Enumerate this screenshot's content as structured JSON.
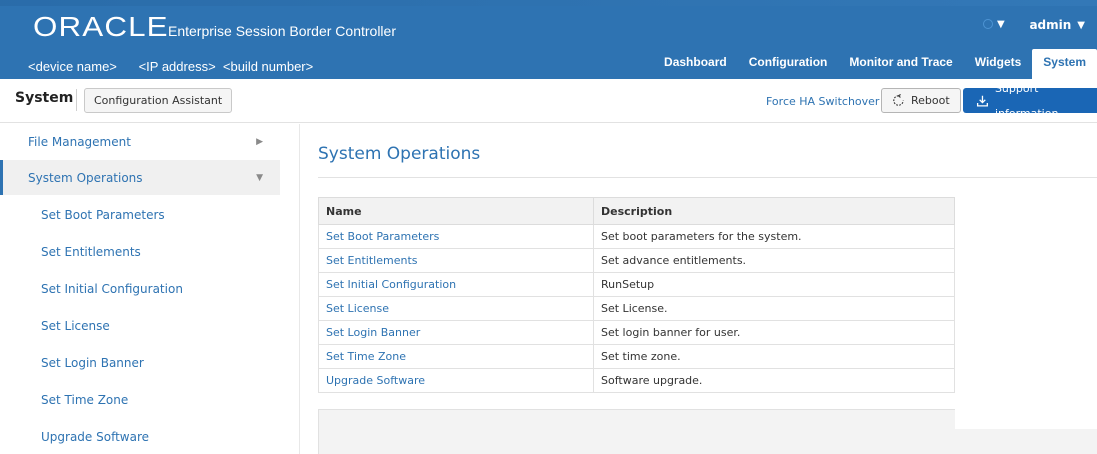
{
  "header": {
    "logo": "ORACLE",
    "app_title": "Enterprise Session Border Controller",
    "device_info": "<device name>      <IP address>  <build number>",
    "user": "admin",
    "nav_tabs": [
      {
        "label": "Dashboard",
        "active": false
      },
      {
        "label": "Configuration",
        "active": false
      },
      {
        "label": "Monitor and Trace",
        "active": false
      },
      {
        "label": "Widgets",
        "active": false
      },
      {
        "label": "System",
        "active": true
      }
    ]
  },
  "subheader": {
    "title": "System",
    "config_assistant": "Configuration Assistant",
    "ha_switchover": "Force HA Switchover",
    "reboot": "Reboot",
    "support": "Support information"
  },
  "sidebar": {
    "items": [
      {
        "label": "File Management",
        "expanded": false
      },
      {
        "label": "System Operations",
        "expanded": true
      }
    ],
    "sub_items": [
      "Set Boot Parameters",
      "Set Entitlements",
      "Set Initial Configuration",
      "Set License",
      "Set Login Banner",
      "Set Time Zone",
      "Upgrade Software"
    ]
  },
  "content": {
    "title": "System Operations",
    "columns": [
      "Name",
      "Description"
    ],
    "rows": [
      {
        "name": "Set Boot Parameters",
        "description": "Set boot parameters for the system."
      },
      {
        "name": "Set Entitlements",
        "description": "Set advance entitlements."
      },
      {
        "name": "Set Initial Configuration",
        "description": "RunSetup"
      },
      {
        "name": "Set License",
        "description": "Set License."
      },
      {
        "name": "Set Login Banner",
        "description": "Set login banner for user."
      },
      {
        "name": "Set Time Zone",
        "description": "Set time zone."
      },
      {
        "name": "Upgrade Software",
        "description": "Software upgrade."
      }
    ]
  },
  "colors": {
    "brand": "#2e73b2",
    "primary_button": "#1a66b5",
    "active_bg": "#f0f0f0"
  }
}
